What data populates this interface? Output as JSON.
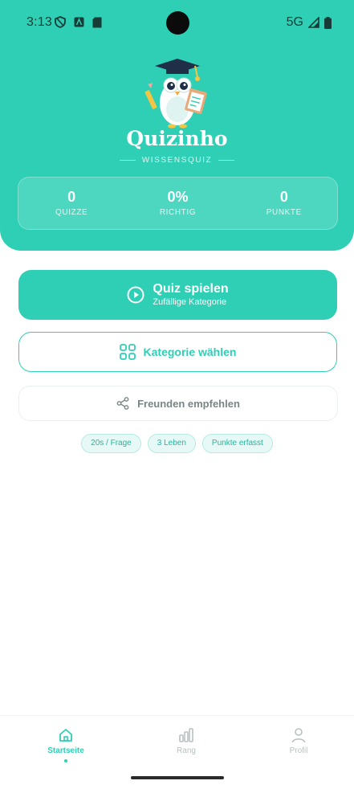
{
  "status": {
    "time": "3:13",
    "network": "5G"
  },
  "app": {
    "title": "Quizinho",
    "subtitle": "WISSENSQUIZ"
  },
  "stats": [
    {
      "value": "0",
      "label": "QUIZZE"
    },
    {
      "value": "0%",
      "label": "RICHTIG"
    },
    {
      "value": "0",
      "label": "PUNKTE"
    }
  ],
  "actions": {
    "play_title": "Quiz spielen",
    "play_subtitle": "Zufällige Kategorie",
    "category_label": "Kategorie wählen",
    "share_label": "Freunden empfehlen"
  },
  "chips": [
    "20s / Frage",
    "3 Leben",
    "Punkte erfasst"
  ],
  "nav": [
    {
      "label": "Startseite",
      "icon": "home-icon",
      "active": true
    },
    {
      "label": "Rang",
      "icon": "bar-chart-icon",
      "active": false
    },
    {
      "label": "Profil",
      "icon": "person-icon",
      "active": false
    }
  ],
  "colors": {
    "accent": "#2ecfb5",
    "text_dark": "#173b36",
    "muted": "#7a8586"
  }
}
